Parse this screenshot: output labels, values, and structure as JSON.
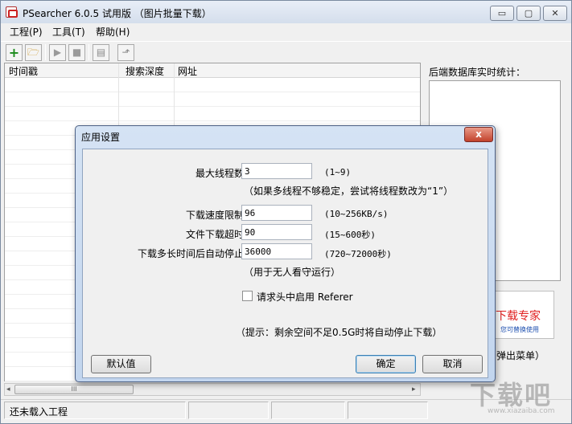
{
  "window": {
    "title": "PSearcher 6.0.5 试用版 （图片批量下载）",
    "controls": {
      "minimize": "▭",
      "maximize": "▢",
      "close": "✕"
    }
  },
  "menu": [
    {
      "label": "工程(P)"
    },
    {
      "label": "工具(T)"
    },
    {
      "label": "帮助(H)"
    }
  ],
  "toolbar": {
    "buttons": [
      {
        "icon": "add-icon",
        "glyph": "+",
        "color": "#1a8a1a"
      },
      {
        "icon": "open-folder-icon",
        "glyph": "🗁",
        "color": "#c8901a"
      },
      {
        "icon": "play-icon",
        "glyph": "▶",
        "color": "#9a9a9a"
      },
      {
        "icon": "stop-icon",
        "glyph": "■",
        "color": "#9a9a9a"
      },
      {
        "icon": "properties-icon",
        "glyph": "▤",
        "color": "#8a8a8a"
      },
      {
        "icon": "export-icon",
        "glyph": "⬏",
        "color": "#8a8a8a"
      }
    ]
  },
  "list": {
    "columns": [
      "时间戳",
      "搜索深度",
      "网址"
    ]
  },
  "right_panel": {
    "stats_label": "后端数据库实时统计：",
    "ad_title": "下载专家",
    "ad_subtitle": "您可替换使用",
    "popup_label": "弹出菜单）"
  },
  "scrollbar": {
    "thumb_grip": "III",
    "left_arrow": "◂",
    "right_arrow": "▸"
  },
  "status": {
    "text": "还未载入工程"
  },
  "watermark": {
    "text": "下载吧",
    "url": "www.xiazaiba.com"
  },
  "dialog": {
    "title": "应用设置",
    "close_label": "x",
    "fields": {
      "max_threads": {
        "label": "最大线程数：",
        "value": "3",
        "range": "(1~9)"
      },
      "threads_note": "（如果多线程不够稳定，尝试将线程数改为“1”）",
      "speed_limit": {
        "label": "下载速度限制：",
        "value": "96",
        "range": "(10~256KB/s)"
      },
      "file_timeout": {
        "label": "文件下载超时：",
        "value": "90",
        "range": "(15~600秒)"
      },
      "auto_stop": {
        "label": "下载多长时间后自动停止：",
        "value": "36000",
        "range": "(720~72000秒)"
      },
      "auto_stop_note": "（用于无人看守运行）",
      "referer": {
        "label": "请求头中启用 Referer",
        "checked": false
      },
      "tip": "（提示：剩余空间不足0.5G时将自动停止下载）"
    },
    "buttons": {
      "defaults": "默认值",
      "ok": "确定",
      "cancel": "取消"
    }
  }
}
